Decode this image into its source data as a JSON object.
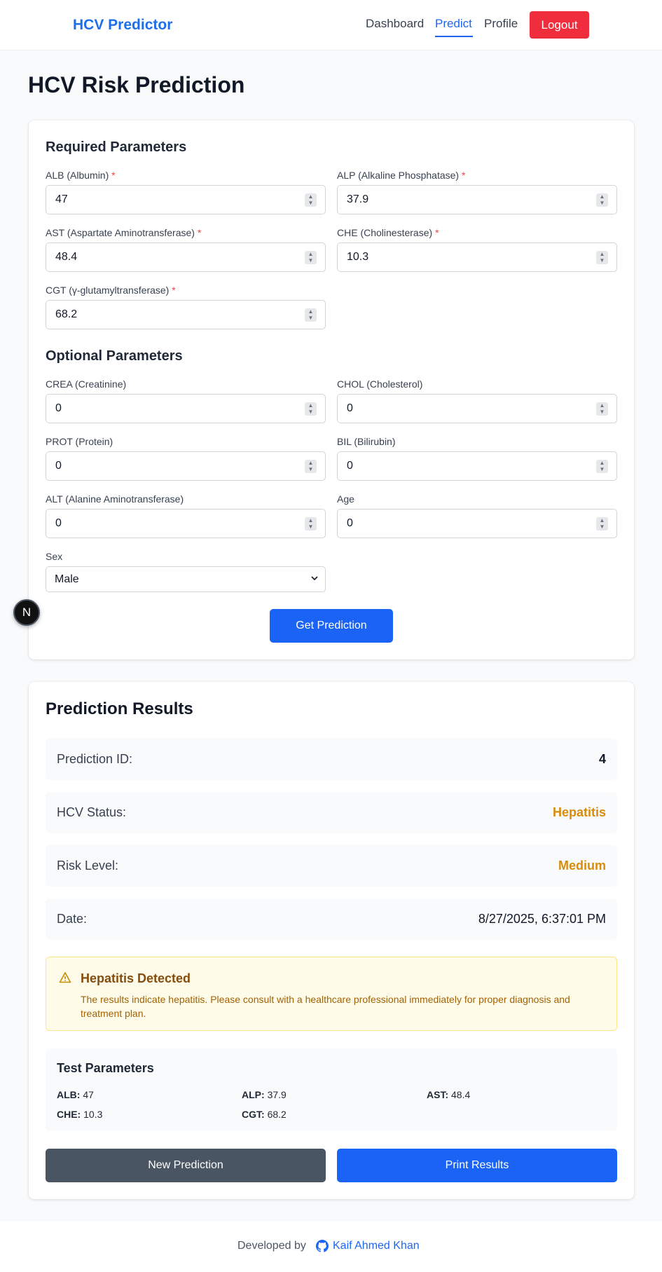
{
  "header": {
    "brand": "HCV Predictor",
    "nav": [
      "Dashboard",
      "Predict",
      "Profile"
    ],
    "active_nav": "Predict",
    "logout": "Logout"
  },
  "page": {
    "title": "HCV Risk Prediction"
  },
  "form": {
    "required_title": "Required Parameters",
    "optional_title": "Optional Parameters",
    "required_fields": [
      {
        "label": "ALB (Albumin)",
        "value": "47"
      },
      {
        "label": "ALP (Alkaline Phosphatase)",
        "value": "37.9"
      },
      {
        "label": "AST (Aspartate Aminotransferase)",
        "value": "48.4"
      },
      {
        "label": "CHE (Cholinesterase)",
        "value": "10.3"
      },
      {
        "label": "CGT (γ-glutamyltransferase)",
        "value": "68.2"
      }
    ],
    "required_marker": "*",
    "optional_fields": [
      {
        "label": "CREA (Creatinine)",
        "value": "0"
      },
      {
        "label": "CHOL (Cholesterol)",
        "value": "0"
      },
      {
        "label": "PROT (Protein)",
        "value": "0"
      },
      {
        "label": "BIL (Bilirubin)",
        "value": "0"
      },
      {
        "label": "ALT (Alanine Aminotransferase)",
        "value": "0"
      },
      {
        "label": "Age",
        "value": "0"
      }
    ],
    "sex": {
      "label": "Sex",
      "value": "Male"
    },
    "submit": "Get Prediction"
  },
  "badge": {
    "letter": "N"
  },
  "results": {
    "title": "Prediction Results",
    "rows": [
      {
        "label": "Prediction ID:",
        "value": "4"
      },
      {
        "label": "HCV Status:",
        "value": "Hepatitis"
      },
      {
        "label": "Risk Level:",
        "value": "Medium"
      },
      {
        "label": "Date:",
        "value": "8/27/2025, 6:37:01 PM"
      }
    ],
    "alert": {
      "title": "Hepatitis Detected",
      "text": "The results indicate hepatitis. Please consult with a healthcare professional immediately for proper diagnosis and treatment plan."
    },
    "params_title": "Test Parameters",
    "params": [
      {
        "name": "ALB:",
        "value": "47"
      },
      {
        "name": "ALP:",
        "value": "37.9"
      },
      {
        "name": "AST:",
        "value": "48.4"
      },
      {
        "name": "CHE:",
        "value": "10.3"
      },
      {
        "name": "CGT:",
        "value": "68.2"
      }
    ],
    "new_prediction": "New Prediction",
    "print": "Print Results"
  },
  "footer": {
    "text": "Developed by",
    "author": "Kaif Ahmed Khan"
  },
  "colors": {
    "primary": "#1a63f5",
    "danger": "#ef2d3c",
    "warning": "#d98c09",
    "secondary": "#4a5563"
  }
}
